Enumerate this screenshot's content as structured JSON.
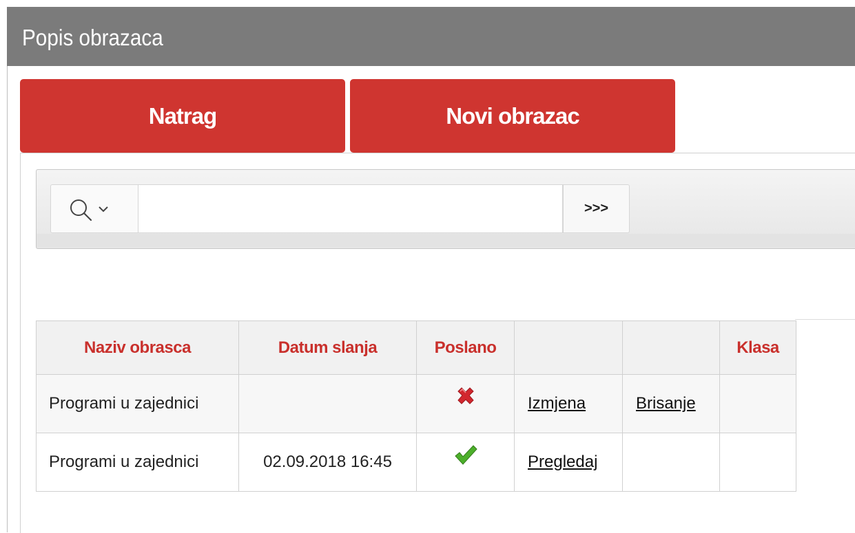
{
  "header": {
    "title": "Popis obrazaca"
  },
  "buttons": {
    "back_label": "Natrag",
    "new_label": "Novi obrazac"
  },
  "search": {
    "value": "",
    "go_label": ">>>",
    "icon": "search-icon"
  },
  "table": {
    "headers": [
      "Naziv obrasca",
      "Datum slanja",
      "Poslano",
      "",
      "",
      "Klasa"
    ],
    "rows": [
      {
        "name": "Programi u zajednici",
        "date": "",
        "sent": "x-icon",
        "action1": "Izmjena",
        "action2": "Brisanje",
        "klasa": ""
      },
      {
        "name": "Programi u zajednici",
        "date": "02.09.2018 16:45",
        "sent": "check-icon",
        "action1": "Pregledaj",
        "action2": "",
        "klasa": ""
      }
    ]
  },
  "colors": {
    "header_bg": "#7b7b7b",
    "button_bg": "#cf3530",
    "table_header_text": "#c9302c",
    "check": "#4caf2a",
    "cross": "#d2272e"
  }
}
